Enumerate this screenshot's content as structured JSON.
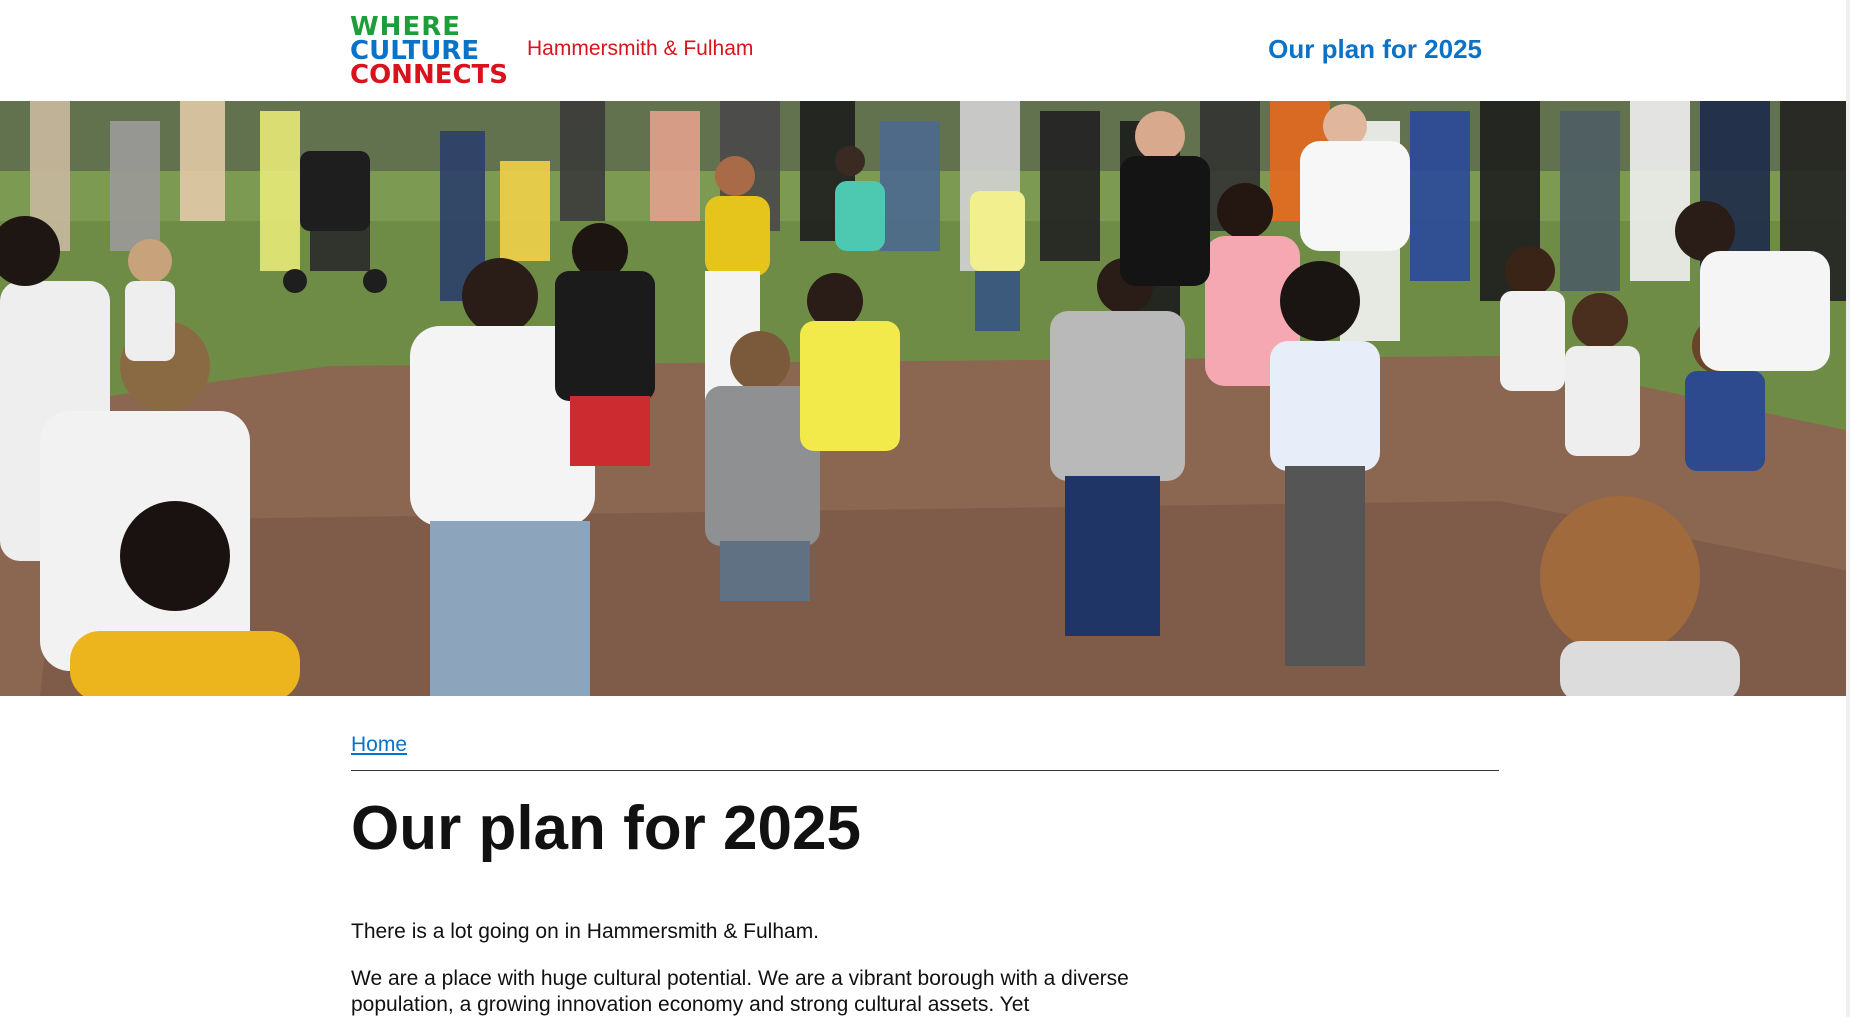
{
  "header": {
    "logo": {
      "line1": "WHERE",
      "line2": "CULTURE",
      "line3": "CONNECTS"
    },
    "borough": "Hammersmith & Fulham",
    "nav_link": "Our plan for 2025"
  },
  "hero": {
    "image_description_icon": "photo-children-dancing"
  },
  "breadcrumb": {
    "home": "Home"
  },
  "page": {
    "title": "Our plan for 2025",
    "paragraphs": [
      "There is a lot going on in Hammersmith & Fulham.",
      "We are a place with huge cultural potential. We are a vibrant borough with a diverse population, a growing innovation economy and strong cultural assets. Yet"
    ]
  },
  "colors": {
    "green": "#1f9d3a",
    "blue": "#0a73c7",
    "red": "#d8131c"
  }
}
